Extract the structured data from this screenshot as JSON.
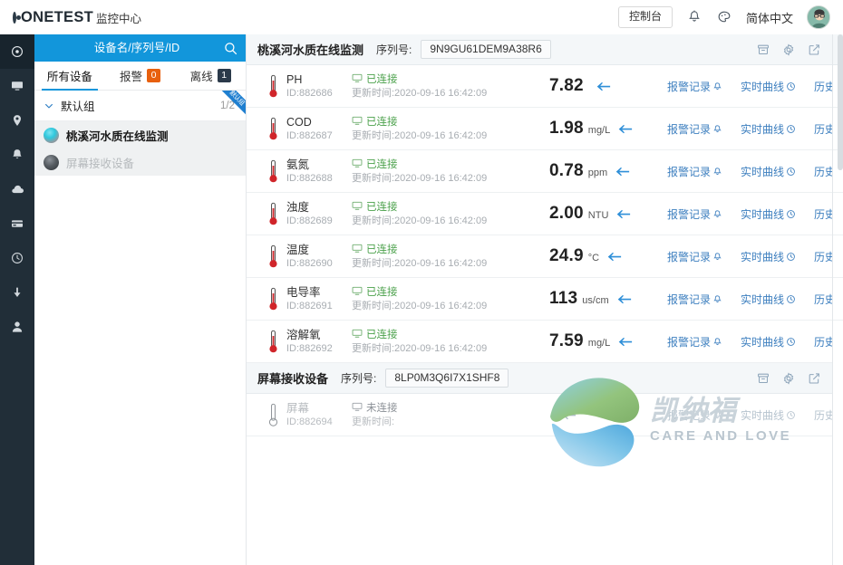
{
  "header": {
    "brand": "ONETEST",
    "module": "监控中心",
    "console_button": "控制台",
    "bell_icon": "bell-icon",
    "theme_icon": "palette-icon",
    "language": "简体中文"
  },
  "rail": {
    "items": [
      {
        "name": "sidebar-item-monitor-center",
        "icon": "target-icon",
        "active": true
      },
      {
        "name": "sidebar-item-device",
        "icon": "monitor-icon",
        "active": false
      },
      {
        "name": "sidebar-item-location",
        "icon": "location-pin-icon",
        "active": false
      },
      {
        "name": "sidebar-item-alarm",
        "icon": "bell-icon",
        "active": false
      },
      {
        "name": "sidebar-item-cloud",
        "icon": "cloud-icon",
        "active": false
      },
      {
        "name": "sidebar-item-card",
        "icon": "card-icon",
        "active": false
      },
      {
        "name": "sidebar-item-history",
        "icon": "clock-icon",
        "active": false
      },
      {
        "name": "sidebar-item-download",
        "icon": "download-icon",
        "active": false
      },
      {
        "name": "sidebar-item-user",
        "icon": "user-icon",
        "active": false
      }
    ]
  },
  "device_panel": {
    "search_placeholder": "设备名/序列号/ID",
    "search_value": "",
    "search_icon": "search-icon",
    "tabs": [
      {
        "label": "所有设备",
        "badge": null,
        "badge_kind": null,
        "active": true
      },
      {
        "label": "报警",
        "badge": "0",
        "badge_kind": "alarm",
        "active": false
      },
      {
        "label": "离线",
        "badge": "1",
        "badge_kind": "offline",
        "active": false
      }
    ],
    "group": {
      "name": "默认组",
      "count": "1/2",
      "ribbon": "默认组",
      "caret_icon": "chevron-down-icon"
    },
    "devices": [
      {
        "label": "桃溪河水质在线监测",
        "state": "online",
        "selected": true
      },
      {
        "label": "屏幕接收设备",
        "state": "offline",
        "selected": true
      }
    ]
  },
  "main": {
    "cards": [
      {
        "title": "桃溪河水质在线监测",
        "sn_label": "序列号:",
        "sn_value": "9N9GU61DEM9A38R6",
        "actions": [
          {
            "name": "archive-icon",
            "label": "archive-icon"
          },
          {
            "name": "gear-icon",
            "label": "gear-icon"
          },
          {
            "name": "edit-icon",
            "label": "edit-icon"
          }
        ],
        "links": [
          {
            "label": "报警记录",
            "icon": "bell-icon"
          },
          {
            "label": "实时曲线",
            "icon": "clock-curve-icon"
          },
          {
            "label": "历史查询",
            "icon": "waveform-icon"
          }
        ],
        "sensors": [
          {
            "name": "PH",
            "id": "ID:882686",
            "conn": "已连接",
            "connected": true,
            "time": "更新时间:2020-09-16 16:42:09",
            "value": "7.82",
            "unit": ""
          },
          {
            "name": "COD",
            "id": "ID:882687",
            "conn": "已连接",
            "connected": true,
            "time": "更新时间:2020-09-16 16:42:09",
            "value": "1.98",
            "unit": "mg/L"
          },
          {
            "name": "氨氮",
            "id": "ID:882688",
            "conn": "已连接",
            "connected": true,
            "time": "更新时间:2020-09-16 16:42:09",
            "value": "0.78",
            "unit": "ppm"
          },
          {
            "name": "浊度",
            "id": "ID:882689",
            "conn": "已连接",
            "connected": true,
            "time": "更新时间:2020-09-16 16:42:09",
            "value": "2.00",
            "unit": "NTU"
          },
          {
            "name": "温度",
            "id": "ID:882690",
            "conn": "已连接",
            "connected": true,
            "time": "更新时间:2020-09-16 16:42:09",
            "value": "24.9",
            "unit": "°C"
          },
          {
            "name": "电导率",
            "id": "ID:882691",
            "conn": "已连接",
            "connected": true,
            "time": "更新时间:2020-09-16 16:42:09",
            "value": "113",
            "unit": "us/cm"
          },
          {
            "name": "溶解氧",
            "id": "ID:882692",
            "conn": "已连接",
            "connected": true,
            "time": "更新时间:2020-09-16 16:42:09",
            "value": "7.59",
            "unit": "mg/L"
          }
        ]
      },
      {
        "title": "屏幕接收设备",
        "sn_label": "序列号:",
        "sn_value": "8LP0M3Q6I7X1SHF8",
        "actions": [
          {
            "name": "archive-icon",
            "label": "archive-icon"
          },
          {
            "name": "gear-icon",
            "label": "gear-icon"
          },
          {
            "name": "edit-icon",
            "label": "edit-icon"
          }
        ],
        "links": [
          {
            "label": "报警记录",
            "icon": "bell-icon"
          },
          {
            "label": "实时曲线",
            "icon": "clock-curve-icon"
          },
          {
            "label": "历史查询",
            "icon": "waveform-icon"
          }
        ],
        "sensors": [
          {
            "name": "屏幕",
            "id": "ID:882694",
            "conn": "未连接",
            "connected": false,
            "time": "更新时间:",
            "value": "",
            "unit": ""
          }
        ]
      }
    ]
  },
  "watermark": {
    "cn": "凯纳福",
    "en": "CARE AND LOVE",
    "logo_icon": "wave-logo-icon"
  },
  "colors": {
    "accent_blue": "#1296db",
    "rail_dark": "#212e38",
    "alarm_orange": "#e8600e",
    "offline_navy": "#2b3a4a",
    "link_blue": "#3d7fbf",
    "connected_green": "#4ba14b"
  }
}
